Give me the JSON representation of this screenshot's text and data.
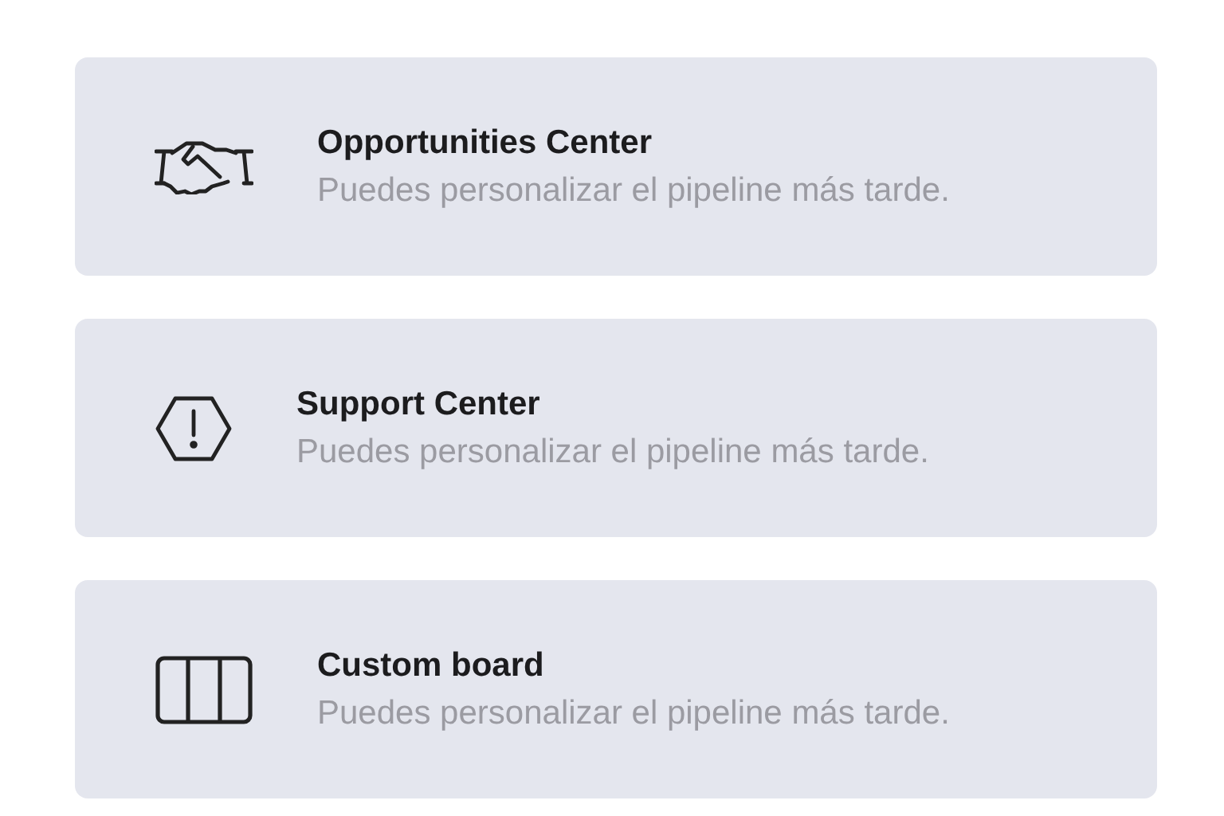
{
  "cards": [
    {
      "kind": "handshake",
      "title": "Opportunities Center",
      "subtitle": "Puedes personalizar el pipeline más tarde."
    },
    {
      "kind": "warning",
      "title": "Support Center",
      "subtitle": "Puedes personalizar el pipeline más tarde."
    },
    {
      "kind": "board",
      "title": "Custom board",
      "subtitle": "Puedes personalizar el pipeline más tarde."
    }
  ]
}
